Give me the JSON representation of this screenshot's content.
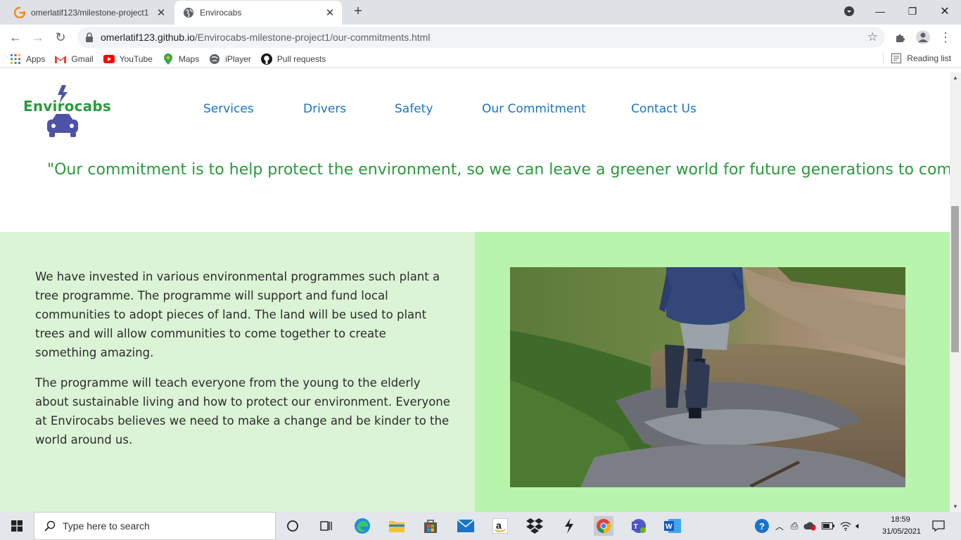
{
  "browser": {
    "tabs": [
      {
        "title": "omerlatif123/milestone-project1",
        "icon": "g-logo-icon"
      },
      {
        "title": "Envirocabs",
        "icon": "globe-icon"
      }
    ],
    "url_host": "omerlatif123.github.io",
    "url_path": "/Envirocabs-milestone-project1/our-commitments.html",
    "bookmarks": [
      {
        "label": "Apps",
        "icon": "apps-grid-icon"
      },
      {
        "label": "Gmail",
        "icon": "gmail-icon"
      },
      {
        "label": "YouTube",
        "icon": "youtube-icon"
      },
      {
        "label": "Maps",
        "icon": "maps-pin-icon"
      },
      {
        "label": "iPlayer",
        "icon": "iplayer-icon"
      },
      {
        "label": "Pull requests",
        "icon": "github-icon"
      }
    ],
    "reading_list": "Reading list"
  },
  "site": {
    "brand": "Envirocabs",
    "nav": [
      "Services",
      "Drivers",
      "Safety",
      "Our Commitment",
      "Contact Us"
    ],
    "quote": "\"Our commitment is to help protect the environment, so we can leave a greener world for future generations to come\".",
    "paragraph1": "We have invested in various environmental programmes such plant a tree programme. The programme will support and fund local communities to adopt pieces of land. The land will be used to plant trees and will allow communities to come together to create something amazing.",
    "paragraph2": "The programme will teach everyone from the young to the elderly about sustainable living and how to protect our environment. Everyone at Envirocabs believes we need to make a change and be kinder to the world around us.",
    "colors": {
      "brand_green": "#2a9a3c",
      "nav_blue": "#1a73c8",
      "left_panel": "#dcf4d6",
      "right_panel": "#b8f4ab"
    }
  },
  "taskbar": {
    "search_placeholder": "Type here to search",
    "time": "18:59",
    "date": "31/05/2021"
  }
}
